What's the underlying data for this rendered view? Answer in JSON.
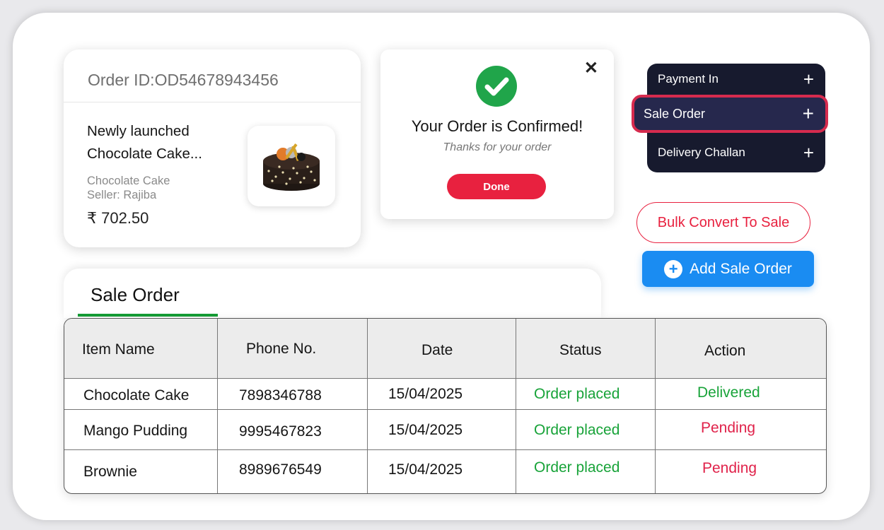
{
  "order_card": {
    "order_id": "Order ID:OD54678943456",
    "product_name": "Newly launched Chocolate Cake...",
    "category": "Chocolate Cake",
    "seller": "Seller: Rajiba",
    "price": "₹ 702.50"
  },
  "confirm_dialog": {
    "close": "✕",
    "title": "Your Order is Confirmed!",
    "subtitle": "Thanks for your order",
    "done_label": "Done"
  },
  "menu": {
    "items": [
      {
        "label": "Payment In"
      },
      {
        "label": "Sale Order"
      },
      {
        "label": "Delivery Challan"
      }
    ],
    "active": "Sale Order"
  },
  "buttons": {
    "bulk_convert": "Bulk Convert To Sale",
    "add_sale_order": "Add Sale Order"
  },
  "sale_order": {
    "tab_label": "Sale Order",
    "columns": [
      "Item Name",
      "Phone No.",
      "Date",
      "Status",
      "Action"
    ],
    "rows": [
      {
        "item": "Chocolate Cake",
        "phone": "7898346788",
        "date": "15/04/2025",
        "status": "Order placed",
        "action": "Delivered"
      },
      {
        "item": "Mango Pudding",
        "phone": "9995467823",
        "date": "15/04/2025",
        "status": "Order placed",
        "action": "Pending"
      },
      {
        "item": "Brownie",
        "phone": "8989676549",
        "date": "15/04/2025",
        "status": "Order placed",
        "action": "Pending"
      }
    ]
  },
  "colors": {
    "accent_red": "#e8213f",
    "accent_blue": "#1a8cf2",
    "status_green": "#18a339",
    "menu_bg": "#171a2e"
  },
  "icons": [
    "plus-icon",
    "check-circle-icon",
    "close-icon",
    "add-circle-icon"
  ]
}
